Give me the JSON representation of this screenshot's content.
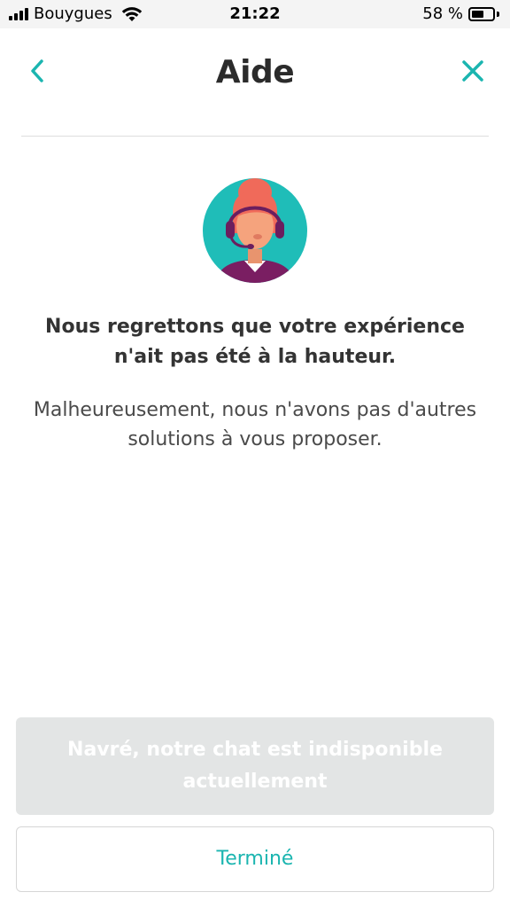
{
  "status_bar": {
    "carrier": "Bouygues",
    "time": "21:22",
    "battery_percent_label": "58 %",
    "battery_level": 0.58,
    "signal_icon": "signal-bars-icon",
    "wifi_icon": "wifi-icon",
    "battery_icon": "battery-icon"
  },
  "header": {
    "title": "Aide",
    "back_icon": "chevron-left-icon",
    "close_icon": "close-icon"
  },
  "illustration": {
    "icon": "support-agent-headset-avatar"
  },
  "message": {
    "headline": "Nous regrettons que votre expérience n'ait pas été à la hauteur.",
    "body": "Malheureusement, nous n'avons pas d'autres solutions à vous proposer."
  },
  "actions": {
    "chat_label": "Navré, notre chat est indisponible actuellement",
    "chat_disabled": true,
    "done_label": "Terminé"
  },
  "colors": {
    "accent": "#1bb5b0",
    "disabled_button": "#e3e5e5",
    "avatar_background": "#1fbdb8",
    "hair": "#f06a5a",
    "headset": "#6b1e5e"
  }
}
